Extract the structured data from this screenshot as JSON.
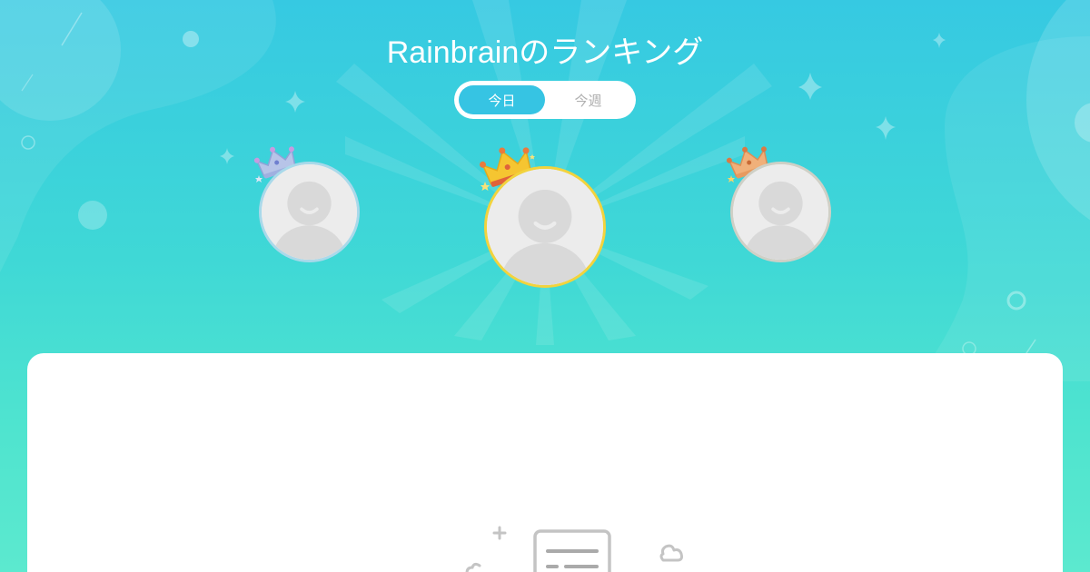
{
  "header": {
    "title": "Rainbrainのランキング"
  },
  "tabs": [
    {
      "label": "今日",
      "active": true
    },
    {
      "label": "今週",
      "active": false
    }
  ],
  "podium": [
    {
      "rank": 2,
      "crown_color": "#b7c4e8",
      "ring_color": "#a9d9ea"
    },
    {
      "rank": 1,
      "crown_color": "#f5c531",
      "ring_color": "#f2d33d"
    },
    {
      "rank": 3,
      "crown_color": "#f0b07a",
      "ring_color": "#cfd0c6"
    }
  ],
  "colors": {
    "accent": "#36c4e3",
    "card_bg": "#ffffff"
  },
  "icons": {
    "empty_state": "empty-list-icon"
  }
}
